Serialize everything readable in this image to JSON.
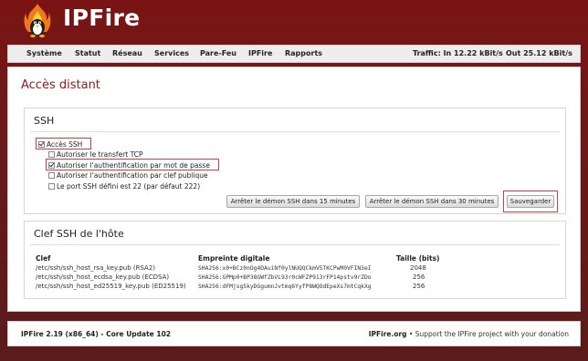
{
  "header": {
    "logo_text": "IPFire",
    "logo_icon": "flame-penguin-icon"
  },
  "nav": {
    "items": [
      "Système",
      "Statut",
      "Réseau",
      "Services",
      "Pare-Feu",
      "IPFire",
      "Rapports"
    ],
    "traffic_in": "Traffic: In 12.22 kBit/s",
    "traffic_out": "Out 25.12 kBit/s"
  },
  "page": {
    "title": "Accès distant"
  },
  "ssh": {
    "title": "SSH",
    "options": [
      {
        "label": "Accès SSH",
        "checked": true
      },
      {
        "label": "Autoriser le transfert TCP",
        "checked": false
      },
      {
        "label": "Autoriser l'authentification par mot de passe",
        "checked": true
      },
      {
        "label": "Autoriser l'authentification par clef publique",
        "checked": false
      },
      {
        "label": "Le port SSH défini est 22 (par défaut 222)",
        "checked": false
      }
    ],
    "buttons": {
      "stop15": "Arrêter le démon SSH dans 15 minutes",
      "stop30": "Arrêter le démon SSH dans 30 minutes",
      "save": "Sauvegarder"
    }
  },
  "hostkeys": {
    "title": "Clef SSH de l'hôte",
    "headers": {
      "key": "Clef",
      "fingerprint": "Empreinte digitale",
      "size": "Taille (bits)"
    },
    "rows": [
      {
        "key": "/etc/ssh/ssh_host_rsa_key.pub (RSA2)",
        "fingerprint": "SHA256:x0+BCz0nOg4DAuiNf0ylNUQQCkmV5TKCPwM0VFIN3eI",
        "size": "2048"
      },
      {
        "key": "/etc/ssh/ssh_host_ecdsa_key.pub (ECDSA)",
        "fingerprint": "SHA256:GPMp0+BP38GWfZbVL93r0cWFZP913rFP14pstv9rZDo",
        "size": "256"
      },
      {
        "key": "/etc/ssh/ssh_host_ed25519_key.pub (ED25519)",
        "fingerprint": "SHA256:dFMjsg5kyDGgumnJvtmq6YyfP8WQOdEpeXs7mtCqkXg",
        "size": "256"
      }
    ]
  },
  "footer": {
    "version": "IPFire 2.19 (x86_64) - Core Update 102",
    "site": "IPFire.org",
    "support": "• Support the IPFire project with your donation"
  },
  "colors": {
    "accent": "#8b1a1a",
    "highlight": "#e23a3a",
    "background": "#6e1e1e"
  }
}
